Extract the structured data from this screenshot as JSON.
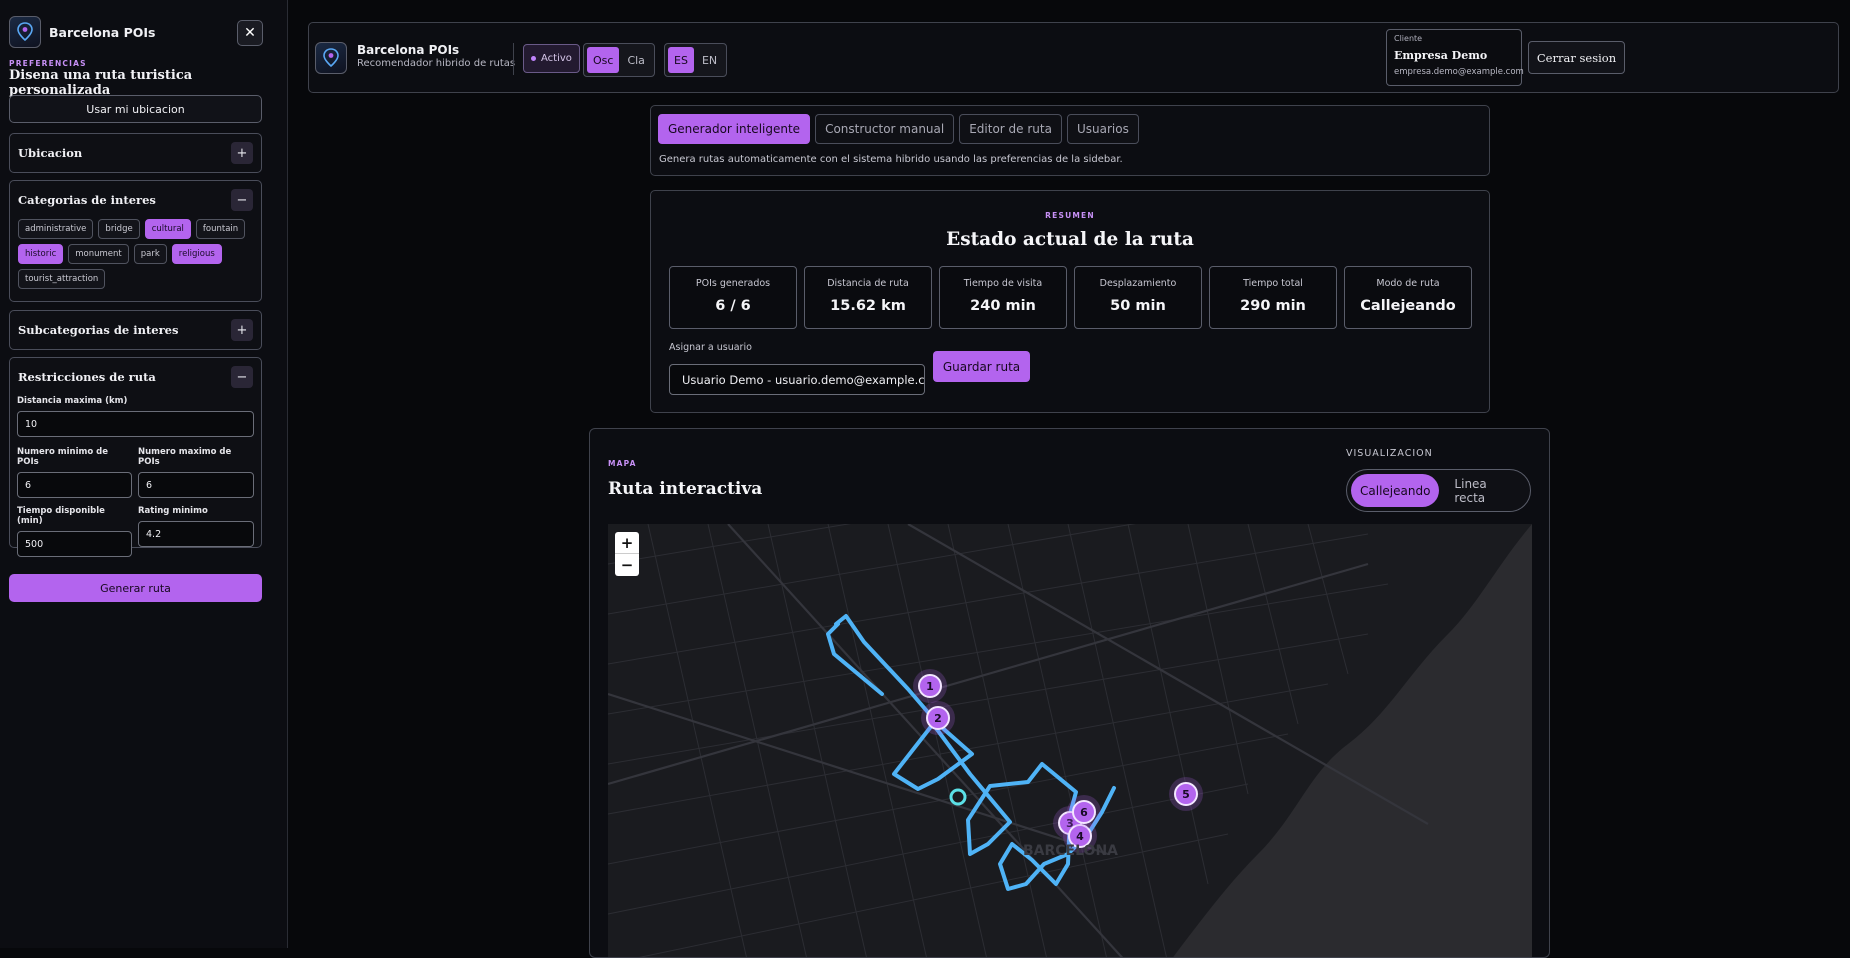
{
  "sidebar": {
    "brand": "Barcelona POIs",
    "close_symbol": "✕",
    "kicker": "PREFERENCIAS",
    "title": "Disena una ruta turistica personalizada",
    "use_location": "Usar mi ubicacion",
    "sections": {
      "location": {
        "title": "Ubicacion",
        "toggle": "+"
      },
      "categories": {
        "title": "Categorias de interes",
        "toggle": "−",
        "chips": [
          {
            "label": "administrative",
            "selected": false
          },
          {
            "label": "bridge",
            "selected": false
          },
          {
            "label": "cultural",
            "selected": true
          },
          {
            "label": "fountain",
            "selected": false
          },
          {
            "label": "historic",
            "selected": true
          },
          {
            "label": "monument",
            "selected": false
          },
          {
            "label": "park",
            "selected": false
          },
          {
            "label": "religious",
            "selected": true
          },
          {
            "label": "tourist_attraction",
            "selected": false
          }
        ]
      },
      "subcategories": {
        "title": "Subcategorias de interes",
        "toggle": "+"
      },
      "restrictions": {
        "title": "Restricciones de ruta",
        "toggle": "−",
        "max_distance": {
          "label": "Distancia maxima (km)",
          "value": "10"
        },
        "min_pois": {
          "label": "Numero minimo de POIs",
          "value": "6"
        },
        "max_pois": {
          "label": "Numero maximo de POIs",
          "value": "6"
        },
        "time": {
          "label": "Tiempo disponible (min)",
          "value": "500"
        },
        "rating": {
          "label": "Rating minimo",
          "value": "4.2"
        }
      }
    },
    "generate": "Generar ruta"
  },
  "header": {
    "app_name": "Barcelona POIs",
    "subtitle": "Recomendador hibrido de rutas",
    "status": "Activo",
    "theme_options": [
      "Osc",
      "Cla"
    ],
    "theme_selected": "Osc",
    "lang_options": [
      "ES",
      "EN"
    ],
    "lang_selected": "ES",
    "client": {
      "kicker": "Cliente",
      "name": "Empresa Demo",
      "email": "empresa.demo@example.com"
    },
    "logout": "Cerrar sesion"
  },
  "tabs": {
    "items": [
      "Generador inteligente",
      "Constructor manual",
      "Editor de ruta",
      "Usuarios"
    ],
    "active": "Generador inteligente",
    "description": "Genera rutas automaticamente con el sistema hibrido usando las preferencias de la sidebar."
  },
  "summary": {
    "kicker": "RESUMEN",
    "title": "Estado actual de la ruta",
    "stats": [
      {
        "label": "POIs generados",
        "value": "6 / 6"
      },
      {
        "label": "Distancia de ruta",
        "value": "15.62 km"
      },
      {
        "label": "Tiempo de visita",
        "value": "240 min"
      },
      {
        "label": "Desplazamiento",
        "value": "50 min"
      },
      {
        "label": "Tiempo total",
        "value": "290 min"
      },
      {
        "label": "Modo de ruta",
        "value": "Callejeando"
      }
    ],
    "assign_label": "Asignar a usuario",
    "assign_value": "Usuario Demo - usuario.demo@example.com",
    "save": "Guardar ruta"
  },
  "map": {
    "kicker": "MAPA",
    "title": "Ruta interactiva",
    "visualization_label": "VISUALIZACION",
    "modes": [
      "Callejeando",
      "Linea recta"
    ],
    "mode_selected": "Callejeando",
    "zoom_in": "+",
    "zoom_out": "−",
    "markers": [
      "1",
      "2",
      "3",
      "4",
      "5",
      "6"
    ],
    "route_color": "#4fb3f6",
    "marker_color": "#b364ee"
  },
  "colors": {
    "accent": "#b364ee",
    "background": "#07080b"
  }
}
